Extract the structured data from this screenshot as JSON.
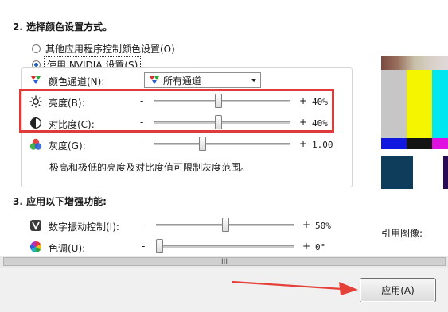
{
  "section2": {
    "heading": "2. 选择颜色设置方式。",
    "radio_other": "其他应用程序控制颜色设置(O)",
    "radio_nvidia": "使用 NVIDIA 设置(S)"
  },
  "color_channel": {
    "label": "颜色通道(N):",
    "selected": "所有通道"
  },
  "brightness": {
    "label": "亮度(B):",
    "minus": "-",
    "plus": "+",
    "value": "40%",
    "level_fraction": 0.47
  },
  "contrast": {
    "label": "对比度(C):",
    "minus": "-",
    "plus": "+",
    "value": "40%",
    "level_fraction": 0.47
  },
  "gamma": {
    "label": "灰度(G):",
    "minus": "-",
    "plus": "+",
    "value": "1.00",
    "level_fraction": 0.35
  },
  "hint": "极高和极低的亮度及对比度值可限制灰度范围。",
  "section3": {
    "heading": "3. 应用以下增强功能:"
  },
  "vibrance": {
    "label": "数字振动控制(I):",
    "minus": "-",
    "plus": "+",
    "value": "50%",
    "level_fraction": 0.5
  },
  "hue": {
    "label": "色调(U):",
    "minus": "-",
    "plus": "+",
    "value": "0°",
    "level_fraction": 0.0
  },
  "reference": {
    "label": "引用图像:"
  },
  "scrollbar": {
    "grip": "III"
  },
  "apply_button": {
    "label": "应用(A)"
  },
  "colors": {
    "highlight": "#e03a3a",
    "arrow": "#e5403a",
    "radio_dot": "#1d5fbf"
  }
}
